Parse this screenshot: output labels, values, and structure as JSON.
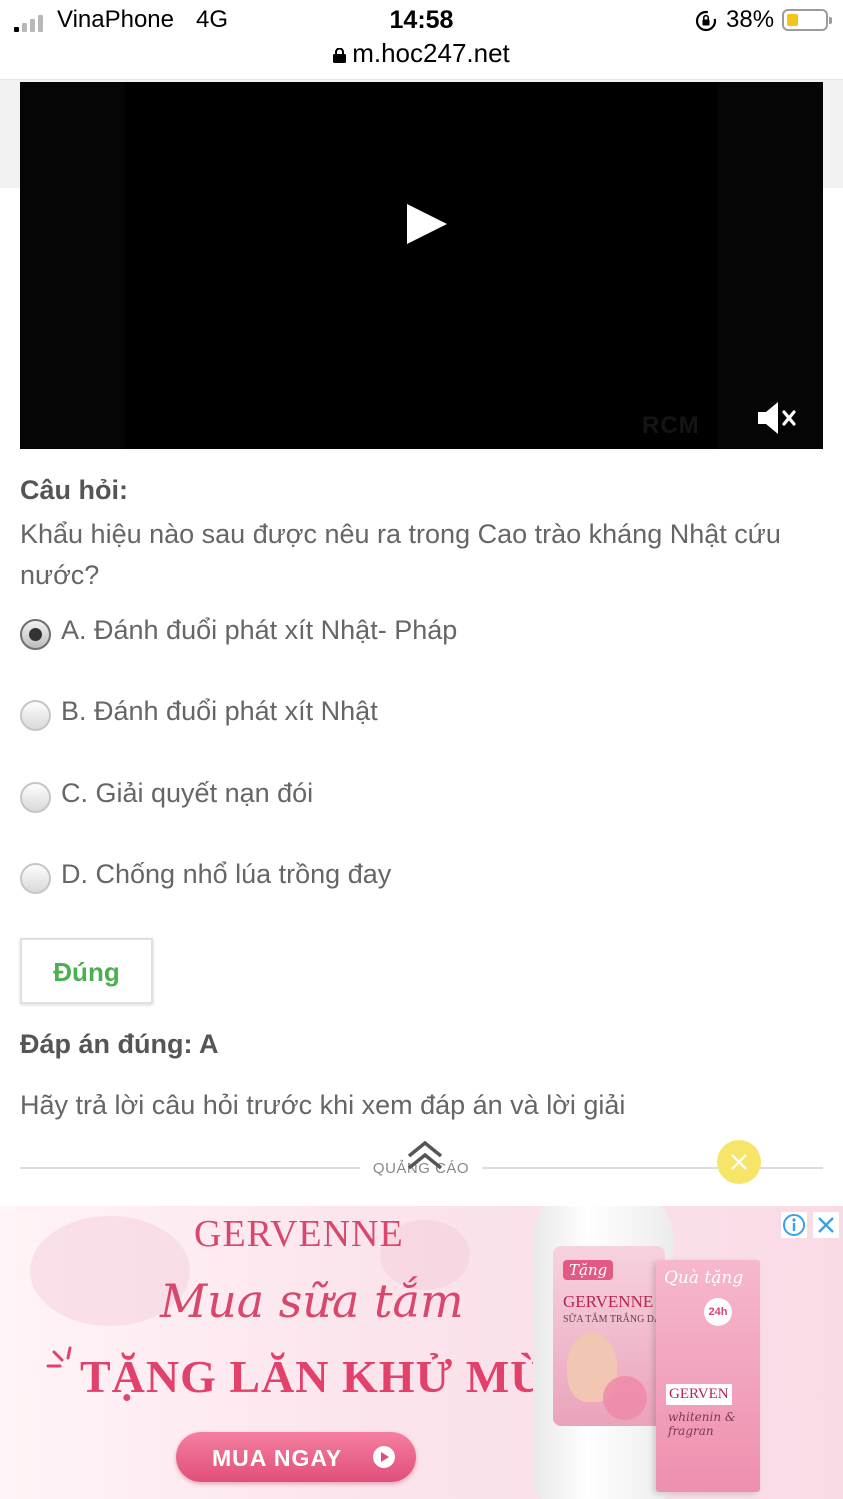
{
  "status_bar": {
    "carrier": "VinaPhone",
    "network": "4G",
    "time": "14:58",
    "battery_percent": "38%",
    "url": "m.hoc247.net"
  },
  "video": {
    "watermark": "RCM",
    "muted": true
  },
  "question": {
    "label": "Câu hỏi:",
    "text": "Khẩu hiệu nào sau được nêu ra trong Cao trào kháng Nhật cứu nước?",
    "selected": "A",
    "options": [
      {
        "key": "A",
        "text": "A. Đánh đuổi phát xít Nhật- Pháp"
      },
      {
        "key": "B",
        "text": "B. Đánh đuổi phát xít Nhật"
      },
      {
        "key": "C",
        "text": "C. Giải quyết nạn đói"
      },
      {
        "key": "D",
        "text": "D. Chống nhổ lúa trồng đay"
      }
    ]
  },
  "result": {
    "label": "Đúng",
    "color": "#4caf50"
  },
  "answer": {
    "line": "Đáp án đúng: A",
    "hint": "Hãy trả lời câu hỏi trước khi xem đáp án và lời giải"
  },
  "ad": {
    "separator_label": "QUẢNG CÁO",
    "brand": "GERVENNE",
    "slogan": "Mua sữa tắm",
    "offer": "TẶNG LĂN KHỬ MÙI",
    "cta": "MUA NGAY",
    "bottle_tag": "Tặng",
    "bottle_brand": "GERVENNE",
    "bottle_sub": "SỮA TẮM TRẮNG DA",
    "box_top": "Quà tặng",
    "box_badge": "24h",
    "box_brand": "GERVEN",
    "box_sub": "whitenin & fragran",
    "accent_color": "#d8476c"
  }
}
